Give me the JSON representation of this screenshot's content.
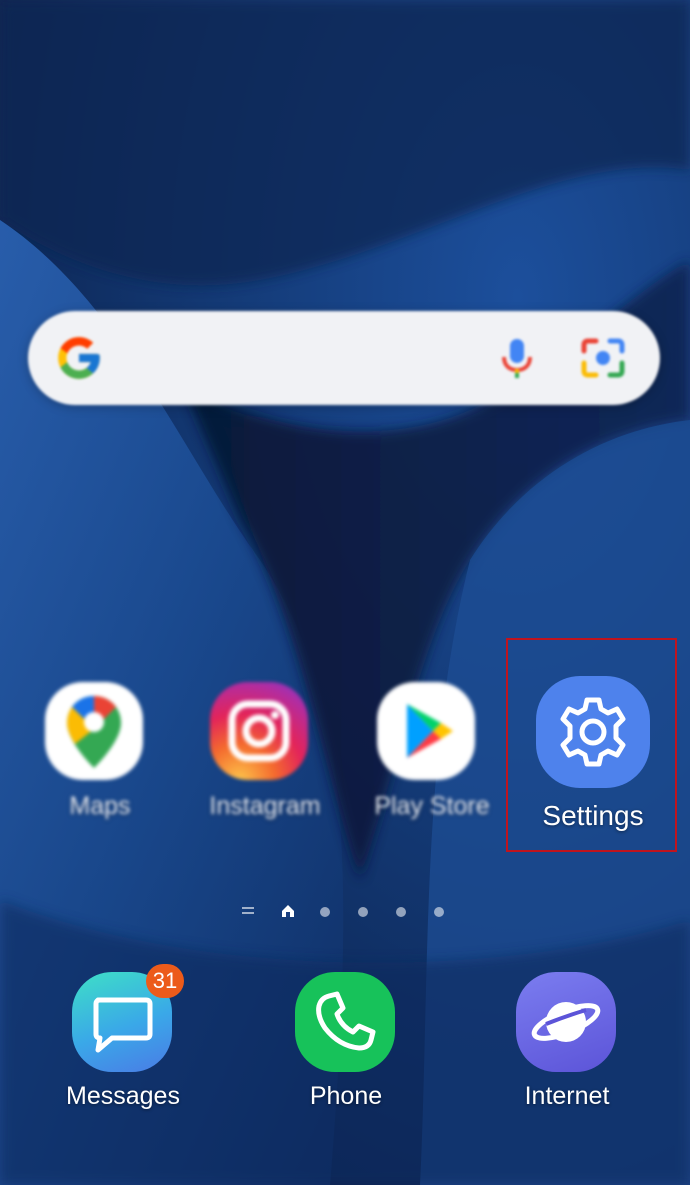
{
  "search": {
    "logo_icon": "google-g-icon",
    "voice_icon": "microphone-icon",
    "lens_icon": "google-lens-icon"
  },
  "home_row": [
    {
      "label": "Maps",
      "icon": "google-maps-icon"
    },
    {
      "label": "Instagram",
      "icon": "instagram-icon"
    },
    {
      "label": "Play Store",
      "icon": "play-store-icon"
    },
    {
      "label": "Settings",
      "icon": "gear-icon",
      "highlighted": true
    }
  ],
  "page_indicator": {
    "current_page": "home",
    "pages": 5
  },
  "dock": [
    {
      "label": "Messages",
      "icon": "message-bubble-icon",
      "badge": "31"
    },
    {
      "label": "Phone",
      "icon": "phone-handset-icon"
    },
    {
      "label": "Internet",
      "icon": "planet-icon"
    }
  ],
  "colors": {
    "settings_icon": "#4e82ec",
    "highlight_border": "#c0141e",
    "badge": "#ec5b1a",
    "phone_icon": "#17c25a",
    "internet_icon": "#6a68e0"
  }
}
